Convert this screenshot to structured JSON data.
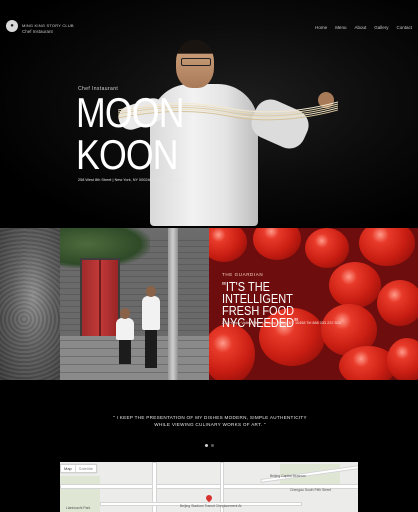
{
  "brand": {
    "name": "MING KING STORY CLUB",
    "subtitle": "Chef Instaurant"
  },
  "nav": {
    "items": [
      "Home",
      "Menu",
      "About",
      "Gallery",
      "Contact"
    ]
  },
  "hero": {
    "kicker": "Chef Instaurant",
    "title": "MOON KOON",
    "address": "258 West 8th Street | New York, NY 000246 | Tel 555 222 222"
  },
  "press": {
    "source": "THE GUARDIAN",
    "headline": "\"IT'S THE INTELLIGENT FRESH FOOD NYC NEEDED\"",
    "meta": "221 Happy Valley Street, Happy Valley, NY 10458 Tel 888 333 222 533"
  },
  "statement": {
    "text": "\" I KEEP THE PRESENTATION OF MY DISHES MODERN, SIMPLE AUTHENTICITY WHILE VIEWING CULINARY WORKS OF ART. \"",
    "slides": 2,
    "active_slide": 0
  },
  "map": {
    "type_options": [
      "Map",
      "Satellite"
    ],
    "selected_type": "Map",
    "labels": [
      "Beijing Capital Museum",
      "Beijing Stadium Transit Cheplacement At",
      "Lianhuachi Park",
      "Chengdu South Fifth Street"
    ]
  },
  "colors": {
    "background": "#000000",
    "tomato": "#c81d12",
    "door": "#b03232",
    "pin": "#d7322e"
  }
}
